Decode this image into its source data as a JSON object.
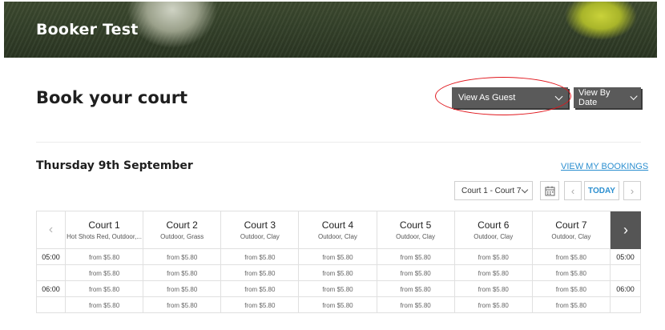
{
  "banner": {
    "title": "Booker Test"
  },
  "page": {
    "title": "Book your court"
  },
  "view_as": {
    "selected": "View As Guest"
  },
  "view_by": {
    "selected": "View By Date"
  },
  "date_heading": "Thursday 9th September",
  "bookings_link": "VIEW MY BOOKINGS",
  "court_range": {
    "selected": "Court 1 - Court 7"
  },
  "today_label": "TODAY",
  "courts": [
    {
      "name": "Court 1",
      "desc": "Hot Shots Red, Outdoor,..."
    },
    {
      "name": "Court 2",
      "desc": "Outdoor, Grass"
    },
    {
      "name": "Court 3",
      "desc": "Outdoor, Clay"
    },
    {
      "name": "Court 4",
      "desc": "Outdoor, Clay"
    },
    {
      "name": "Court 5",
      "desc": "Outdoor, Clay"
    },
    {
      "name": "Court 6",
      "desc": "Outdoor, Clay"
    },
    {
      "name": "Court 7",
      "desc": "Outdoor, Clay"
    }
  ],
  "rows": [
    {
      "time": "05:00",
      "prices": [
        "from $5.80",
        "from $5.80",
        "from $5.80",
        "from $5.80",
        "from $5.80",
        "from $5.80",
        "from $5.80"
      ]
    },
    {
      "time": "",
      "prices": [
        "from $5.80",
        "from $5.80",
        "from $5.80",
        "from $5.80",
        "from $5.80",
        "from $5.80",
        "from $5.80"
      ]
    },
    {
      "time": "06:00",
      "prices": [
        "from $5.80",
        "from $5.80",
        "from $5.80",
        "from $5.80",
        "from $5.80",
        "from $5.80",
        "from $5.80"
      ]
    },
    {
      "time": "",
      "prices": [
        "from $5.80",
        "from $5.80",
        "from $5.80",
        "from $5.80",
        "from $5.80",
        "from $5.80",
        "from $5.80"
      ]
    }
  ],
  "colors": {
    "dark_button": "#5a5a5a",
    "link": "#2c8fd0",
    "highlight": "#e0151b"
  },
  "icons": {
    "calendar": "calendar-icon",
    "prev": "chevron-left-icon",
    "next": "chevron-right-icon"
  }
}
